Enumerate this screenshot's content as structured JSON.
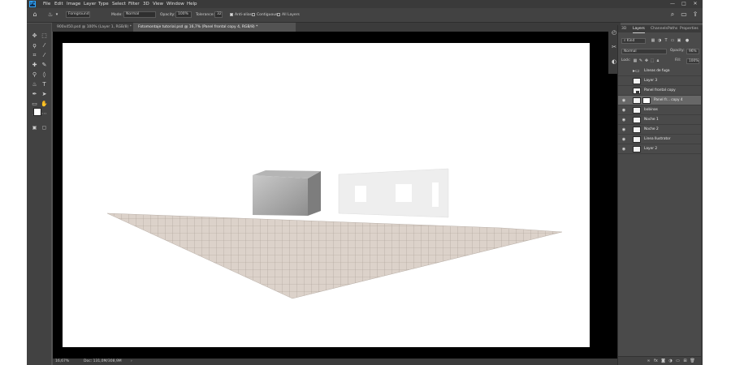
{
  "app": {
    "logo_text": "Ps"
  },
  "menu": [
    "File",
    "Edit",
    "Image",
    "Layer",
    "Type",
    "Select",
    "Filter",
    "3D",
    "View",
    "Window",
    "Help"
  ],
  "window_controls": {
    "minimize": "—",
    "maximize": "□",
    "close": "✕"
  },
  "options_bar": {
    "tool_icon": "paint-bucket-icon",
    "fill_source": "Foreground",
    "mode_label": "Mode:",
    "mode_value": "Normal",
    "opacity_label": "Opacity:",
    "opacity_value": "100%",
    "tolerance_label": "Tolerance:",
    "tolerance_value": "32",
    "anti_alias_label": "Anti-alias",
    "contiguous_label": "Contiguous",
    "all_layers_label": "All Layers"
  },
  "tabs": [
    {
      "label": "900x450.psd @ 100% (Layer 1, RGB/8) *",
      "active": false
    },
    {
      "label": "Fotomontaje tutorial.psd @ 16,7% (Panel frontal copy 4, RGB/8) *",
      "active": true
    }
  ],
  "status": {
    "zoom": "16,67%",
    "doc": "Doc: 131,0M/308,9M"
  },
  "layers_panel": {
    "tabs": [
      "3D",
      "Layers",
      "Channels",
      "Paths",
      "Properties"
    ],
    "active_tab": "Layers",
    "kind_label": "Kind",
    "blend_mode": "Normal",
    "opacity_label": "Opacity:",
    "opacity_value": "96%",
    "lock_label": "Lock:",
    "fill_label": "Fill:",
    "fill_value": "100%",
    "layers": [
      {
        "name": "Líneas de fuga",
        "visible": false,
        "type": "folder",
        "selected": false
      },
      {
        "name": "Layer 3",
        "visible": false,
        "type": "pixel",
        "selected": false
      },
      {
        "name": "Panel frontal copy",
        "visible": false,
        "type": "smart",
        "selected": false
      },
      {
        "name": "Panel fr... copy 4",
        "visible": true,
        "type": "smart-mask",
        "selected": true
      },
      {
        "name": "bobinas",
        "visible": true,
        "type": "smart",
        "selected": false
      },
      {
        "name": "Noche 1",
        "visible": true,
        "type": "smart",
        "selected": false
      },
      {
        "name": "Noche 2",
        "visible": true,
        "type": "pixel",
        "selected": false
      },
      {
        "name": "Linea Ilustrator",
        "visible": true,
        "type": "pixel",
        "selected": false
      },
      {
        "name": "Layer 2",
        "visible": true,
        "type": "pixel",
        "selected": false
      }
    ]
  }
}
